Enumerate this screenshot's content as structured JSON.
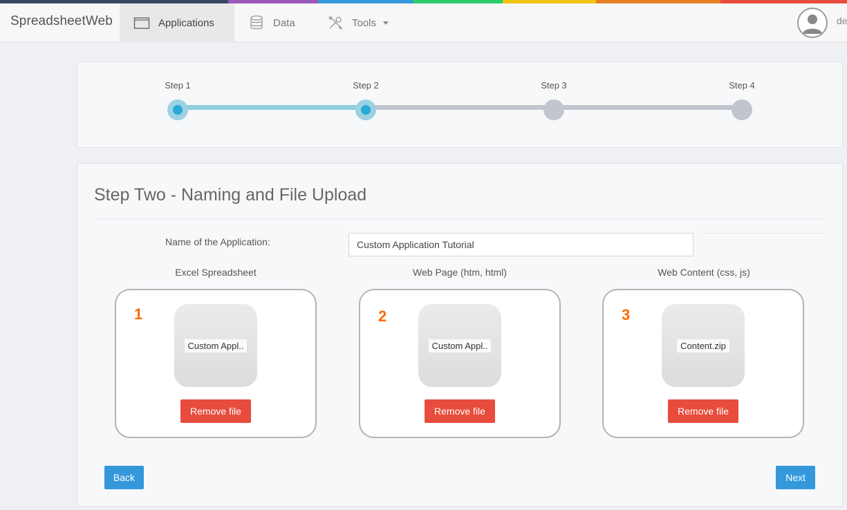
{
  "brand": {
    "name": "SpreadsheetWeb"
  },
  "nav": {
    "applications": "Applications",
    "data": "Data",
    "tools": "Tools",
    "user_truncated": "de"
  },
  "rainbow_colors": [
    "#34495e",
    "#34495e",
    "#9b59b6",
    "#3498db",
    "#2ecc71",
    "#f1c40f",
    "#e67e22",
    "#e74c3c"
  ],
  "wizard": {
    "steps": [
      {
        "label": "Step 1",
        "state": "complete"
      },
      {
        "label": "Step 2",
        "state": "current"
      },
      {
        "label": "Step 3",
        "state": "pending"
      },
      {
        "label": "Step 4",
        "state": "pending"
      }
    ]
  },
  "form": {
    "title": "Step Two - Naming and File Upload",
    "name_label": "Name of the Application:",
    "name_value": "Custom Application Tutorial",
    "uploads": [
      {
        "label": "Excel Spreadsheet",
        "number": "1",
        "file_name": "Custom Appl..",
        "remove_label": "Remove file"
      },
      {
        "label": "Web Page (htm, html)",
        "number": "2",
        "file_name": "Custom Appl..",
        "remove_label": "Remove file"
      },
      {
        "label": "Web Content (css, js)",
        "number": "3",
        "file_name": "Content.zip",
        "remove_label": "Remove file"
      }
    ],
    "back_label": "Back",
    "next_label": "Next"
  },
  "colors": {
    "accent_blue": "#3498db",
    "danger_red": "#e74c3c",
    "step_done": "#2aa8d6",
    "step_done_ring": "#9bd2e2",
    "step_pending": "#c2c5cd",
    "number_orange": "#ff6a00"
  },
  "icons": {
    "applications": "folder-icon",
    "data": "database-icon",
    "tools": "tools-icon",
    "user": "user-avatar-icon"
  }
}
